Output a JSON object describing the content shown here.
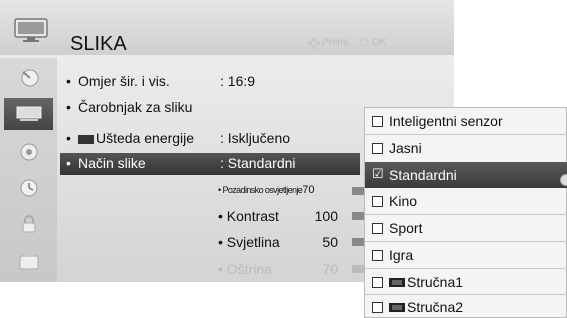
{
  "header": {
    "title": "SLIKA",
    "hint_move": "Premj.",
    "hint_ok": "OK"
  },
  "sidebar": {
    "items": [
      {
        "icon": "satellite-dish-icon",
        "active": false
      },
      {
        "icon": "picture-icon",
        "active": true
      },
      {
        "icon": "audio-speaker-icon",
        "active": false
      },
      {
        "icon": "clock-icon",
        "active": false
      },
      {
        "icon": "lock-icon",
        "active": false
      },
      {
        "icon": "options-icon",
        "active": false
      }
    ]
  },
  "menu": {
    "items": [
      {
        "label": "Omjer šir. i vis.",
        "value": ": 16:9"
      },
      {
        "label": "Čarobnjak za sliku",
        "value": ""
      },
      {
        "label": "Ušteda energije",
        "value": ": Isključeno"
      },
      {
        "label": "Način slike",
        "value": ": Standardni"
      }
    ],
    "sub_items": [
      {
        "label": "• Pozadinsko osvjetljenje",
        "value": "70"
      },
      {
        "label": "• Kontrast",
        "value": "100"
      },
      {
        "label": "• Svjetlina",
        "value": "50"
      },
      {
        "label": "• Oštrina",
        "value": "70"
      }
    ]
  },
  "dropdown": {
    "options": [
      {
        "label": "Inteligentni senzor",
        "selected": false
      },
      {
        "label": "Jasni",
        "selected": false
      },
      {
        "label": "Standardni",
        "selected": true
      },
      {
        "label": "Kino",
        "selected": false
      },
      {
        "label": "Sport",
        "selected": false
      },
      {
        "label": "Igra",
        "selected": false
      },
      {
        "label": "Stručna1",
        "selected": false,
        "expert": true
      },
      {
        "label": "Stručna2",
        "selected": false,
        "expert": true
      }
    ]
  }
}
